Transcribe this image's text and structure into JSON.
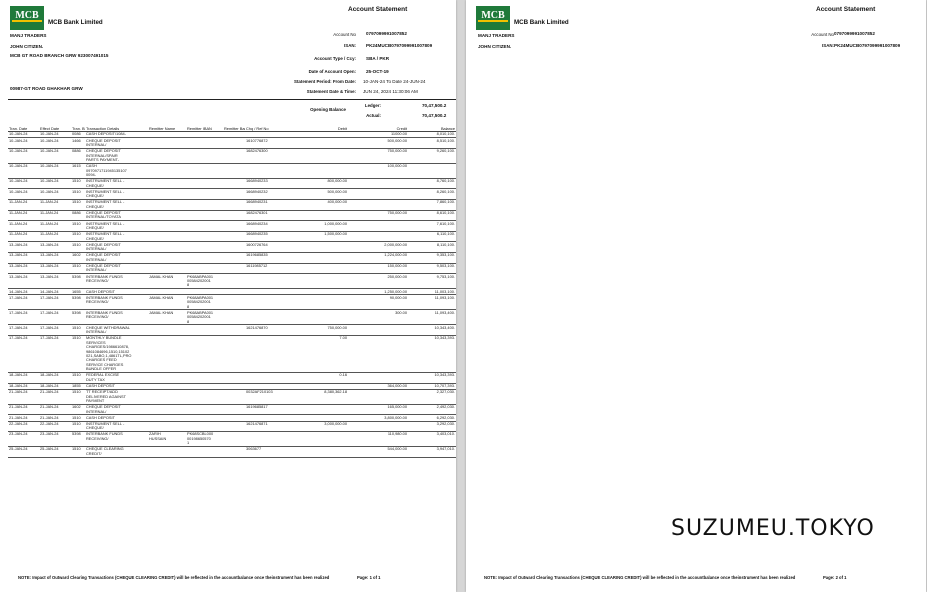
{
  "header": {
    "bank_name": "MCB Bank Limited",
    "doc_title": "Account  Statement",
    "account_no_label": "Account No",
    "account_no": "0797099991007852",
    "iban_label": "ISAN:",
    "iban": "PK24MUCB0797099991007809",
    "account_type_label": "Account Type / Ccy:",
    "account_type": "SBA  /  PKR",
    "open_label": "Date of Account Open:",
    "open_value": "25-OCT-19",
    "period_label": "Statement Period:  From Date:",
    "period_value": "10-JAN-24  To Date  24-JUN-24",
    "stmt_date_label": "Statement Date & Time:",
    "stmt_date_value": "JUN 24, 2024 11:30:06 AM"
  },
  "customer": {
    "name": "MANJ TRADERS",
    "person": "JOHN CITIZEN.",
    "branch_line": "MCB GT ROAD BRANCH GRW     923007491015",
    "branch_code": "00987-GT ROAD GHAKHAR GRW"
  },
  "balances": {
    "opening_label": "Opening  Balance",
    "ledger_label": "Ledger:",
    "ledger_value": "70,47,500.2",
    "actual_label": "Actual:",
    "actual_value": "70,47,500.2"
  },
  "table": {
    "headers": [
      "Tran. Date",
      "Effect Date",
      "Tran. Bk",
      "Transaction Details",
      "Remitter Name",
      "Remitter IBAN",
      "Remitter Bank",
      "Chq / Ref No",
      "Debit",
      "Credit",
      "Balance"
    ],
    "rows": [
      [
        "10-JAN-24",
        "10-JAN-24",
        "0086",
        "CASH DEPOSIT/1084-",
        "",
        "",
        "",
        "",
        "",
        "11000.00",
        "8,010,100."
      ],
      [
        "10-JAN-24",
        "10-JAN-24",
        "1466",
        "CHEQUE DEPOSIT\nINTERNAL/",
        "",
        "",
        "",
        "1610776872",
        "",
        "500,000.00",
        "8,510,100."
      ],
      [
        "10-JAN-24",
        "10-JAN-24",
        "0886",
        "CHEQUE DEPOSIT\nINTERNAL/SPAIR\nPARTS PAYMENT-",
        "",
        "",
        "",
        "1682476300",
        "",
        "750,000.00",
        "9,260,100."
      ],
      [
        "10-JAN-24",
        "10-JAN-24",
        "1615",
        "CASH\n0970971711945135107\n0094-",
        "",
        "",
        "",
        "",
        "",
        "100,000.00",
        ""
      ],
      [
        "10-JAN-24",
        "10-JAN-24",
        "1510",
        "INSTRUMENT SELL -\nCHEQUE/",
        "",
        "",
        "",
        "1668940233",
        "800,000.00",
        "",
        "8,760,100."
      ],
      [
        "10-JAN-24",
        "10-JAN-24",
        "1510",
        "INSTRUMENT SELL -\nCHEQUE/",
        "",
        "",
        "",
        "1668940232",
        "500,000.00",
        "",
        "8,260,100."
      ],
      [
        "11-JAN-24",
        "11-JAN-24",
        "1510",
        "INSTRUMENT SELL -\nCHEQUE/",
        "",
        "",
        "",
        "1668940231",
        "400,000.00",
        "",
        "7,860,100."
      ],
      [
        "11-JAN-24",
        "11-JAN-24",
        "0886",
        "CHEQUE DEPOSIT\nINTERNAL/TOYATA",
        "",
        "",
        "",
        "1682476301",
        "",
        "750,000.00",
        "8,610,100."
      ],
      [
        "11-JAN-24",
        "11-JAN-24",
        "1510",
        "INSTRUMENT SELL -\nCHEQUE/",
        "",
        "",
        "",
        "1668940234",
        "1,000,000.00",
        "",
        "7,610,100."
      ],
      [
        "11-JAN-24",
        "11-JAN-24",
        "1510",
        "INSTRUMENT SELL -\nCHEQUE/",
        "",
        "",
        "",
        "1668940235",
        "1,500,000.00",
        "",
        "6,110,100."
      ],
      [
        "13-JAN-24",
        "13-JAN-24",
        "1510",
        "CHEQUE DEPOSIT\nINTERNAL/",
        "",
        "",
        "",
        "1600726764",
        "",
        "2,000,000.00",
        "8,110,100."
      ],
      [
        "13-JAN-24",
        "13-JAN-24",
        "1602",
        "CHEQUE DEPOSIT\nINTERNAL/",
        "",
        "",
        "",
        "1619685835",
        "",
        "1,224,000.00",
        "9,353,100."
      ],
      [
        "13-JAN-24",
        "13-JAN-24",
        "1510",
        "CHEQUE DEPOSIT\nINTERNAL/",
        "",
        "",
        "",
        "1611985712",
        "",
        "150,000.00",
        "9,503,100."
      ],
      [
        "13-JAN-24",
        "13-JAN-24",
        "5398",
        "INTERBANK FUNDS\nRECEIVING/",
        "JAMAL KHAN",
        "PK68ABPA001\n00584202001\n8",
        "",
        "",
        "",
        "250,000.00",
        "9,753,100."
      ],
      [
        "14-JAN-24",
        "14-JAN-24",
        "1655",
        "CASH DEPOSIT",
        "",
        "",
        "",
        "",
        "",
        "1,250,000.00",
        "11,003,100."
      ],
      [
        "17-JAN-24",
        "17-JAN-24",
        "5398",
        "INTERBANK FUNDS\nRECEIVING/",
        "JAMAL KHAN",
        "PK68ABPA001\n00584202001\n8",
        "",
        "",
        "",
        "90,000.00",
        "11,093,100."
      ],
      [
        "17-JAN-24",
        "17-JAN-24",
        "5398",
        "INTERBANK FUNDS\nRECEIVING/",
        "JAMAL KHAN",
        "PK68ABPA001\n00584202001\n8",
        "",
        "",
        "",
        "300.00",
        "11,093,400."
      ],
      [
        "17-JAN-24",
        "17-JAN-24",
        "1510",
        "CHEQUE WITHDRAWAL\nINTERNAL/",
        "",
        "",
        "",
        "1621476870",
        "750,000.00",
        "",
        "10,343,400."
      ],
      [
        "17-JAN-24",
        "17-JAN-24",
        "1510",
        "MONTHLY BUNDLE\nSERVICES\nCHARGES/1986610878,\n9861084696,1510,15102\n021,SABO,1,4861TL,PRO\nCHARGES FEED\nSERVICE CHARGES\nBUNDLE OFFER",
        "",
        "",
        "",
        "",
        "7.00",
        "",
        "10,343,393."
      ],
      [
        "18-JAN-24",
        "18-JAN-24",
        "1510",
        "FEDERAL EXCISE\nDUTY TAX",
        "",
        "",
        "",
        "",
        "0.16",
        "",
        "10,343,393."
      ],
      [
        "18-JAN-24",
        "18-JAN-24",
        "1855",
        "CASH DEPOSIT",
        "",
        "",
        "",
        "",
        "",
        "364,000.00",
        "10,707,393."
      ],
      [
        "21-JAN-24",
        "21-JAN-24",
        "1510",
        "TT RECEIPT/ADD\nDELIVERED AGAINST\nPAYMENT",
        "",
        "",
        "",
        "0032AF210103",
        "8,380,362.18",
        "",
        "2,327,030."
      ],
      [
        "21-JAN-24",
        "21-JAN-24",
        "1602",
        "CHEQUE DEPOSIT\nINTERNAL/",
        "",
        "",
        "",
        "1619685817",
        "",
        "165,000.00",
        "2,492,030."
      ],
      [
        "21-JAN-24",
        "21-JAN-24",
        "1510",
        "CASH DEPOSIT",
        "",
        "",
        "",
        "",
        "",
        "3,800,000.00",
        "6,292,030."
      ],
      [
        "22-JAN-24",
        "22-JAN-24",
        "1510",
        "INSTRUMENT SELL -\nCHEQUE/",
        "",
        "",
        "",
        "1621476871",
        "3,000,000.00",
        "",
        "3,292,030."
      ],
      [
        "23-JAN-24",
        "23-JAN-24",
        "5398",
        "INTERBANK FUNDS\nRECEIVING/",
        "ZARIH\nHUSSAIN",
        "PK68SCBL000\n00198650570\n1",
        "",
        "",
        "",
        "110,980.00",
        "3,403,010."
      ],
      [
        "25-JAN-24",
        "25-JAN-24",
        "1510",
        "CHEQUE CLEARING\nCREDIT/",
        "",
        "",
        "",
        "3063677",
        "",
        "544,000.00",
        "3,947,010."
      ]
    ]
  },
  "footer": {
    "note": "NOTE: Impact of Outward Clearing Transactions (CHEQUE CLEARING CREDIT) will be reflected in the accountbalance once theinstrument has been realized",
    "page1": "Page:  1 of 1",
    "page2": "Page:  2 of 1"
  },
  "watermark": "SUZUMEU.TOKYO",
  "logo_text": "MCB"
}
